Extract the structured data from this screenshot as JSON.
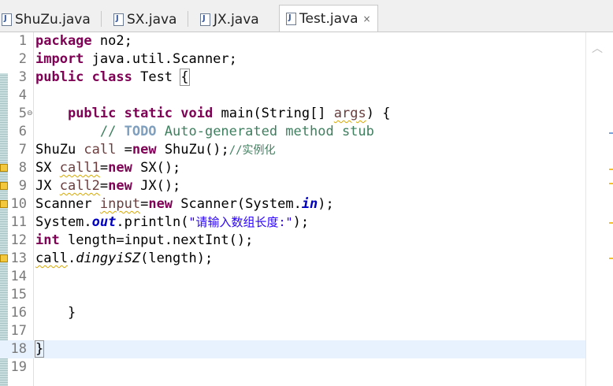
{
  "tabs": [
    {
      "label": "ShuZu.java",
      "active": false
    },
    {
      "label": "SX.java",
      "active": false
    },
    {
      "label": "JX.java",
      "active": false
    },
    {
      "label": "Test.java",
      "active": true,
      "close": "×"
    }
  ],
  "editor": {
    "lines": [
      {
        "n": "1"
      },
      {
        "n": "2"
      },
      {
        "n": "3"
      },
      {
        "n": "4"
      },
      {
        "n": "5"
      },
      {
        "n": "6"
      },
      {
        "n": "7"
      },
      {
        "n": "8"
      },
      {
        "n": "9"
      },
      {
        "n": "10"
      },
      {
        "n": "11"
      },
      {
        "n": "12"
      },
      {
        "n": "13"
      },
      {
        "n": "14"
      },
      {
        "n": "15"
      },
      {
        "n": "16"
      },
      {
        "n": "17"
      },
      {
        "n": "18"
      },
      {
        "n": "19"
      }
    ],
    "t": {
      "l1a": "package",
      "l1b": " no2;",
      "l2a": "import",
      "l2b": " java.util.Scanner;",
      "l3a": "public",
      "l3b": " ",
      "l3c": "class",
      "l3d": " Test ",
      "l3e": "{",
      "l5a": "    ",
      "l5b": "public",
      "l5c": " ",
      "l5d": "static",
      "l5e": " ",
      "l5f": "void",
      "l5g": " main(String[] ",
      "l5h": "args",
      "l5i": ") {",
      "l6a": "        // ",
      "l6b": "TODO",
      "l6c": " Auto-generated method stub",
      "l7a": "ShuZu ",
      "l7b": "call",
      "l7c": " =",
      "l7d": "new",
      "l7e": " ShuZu();",
      "l7f": "//实例化",
      "l8a": "SX ",
      "l8b": "call1",
      "l8c": "=",
      "l8d": "new",
      "l8e": " SX();",
      "l9a": "JX ",
      "l9b": "call2",
      "l9c": "=",
      "l9d": "new",
      "l9e": " JX();",
      "l10a": "Scanner ",
      "l10b": "input",
      "l10c": "=",
      "l10d": "new",
      "l10e": " Scanner(System.",
      "l10f": "in",
      "l10g": ");",
      "l11a": "System.",
      "l11b": "out",
      "l11c": ".println(",
      "l11d": "\"请输入数组长度:\"",
      "l11e": ");",
      "l12a": "int",
      "l12b": " length=input.nextInt();",
      "l13a": "call",
      "l13b": ".",
      "l13c": "dingyiSZ",
      "l13d": "(length);",
      "l16a": "    }",
      "l18a": "}"
    }
  },
  "ui": {
    "fold_glyph": "⊖",
    "scroll_up": "︿"
  }
}
